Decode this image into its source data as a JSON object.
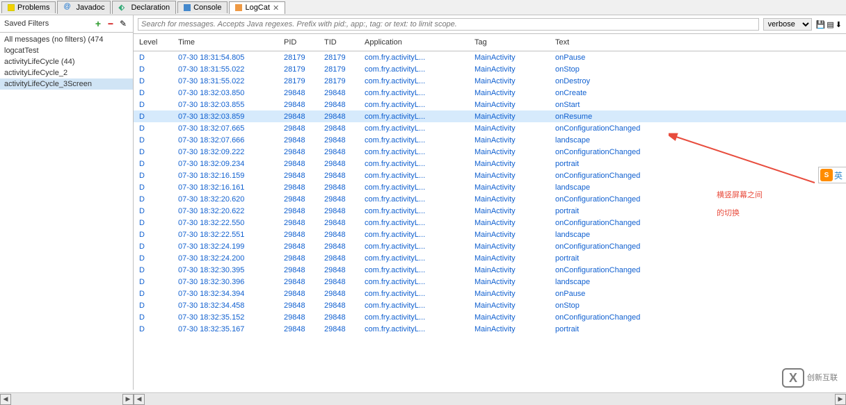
{
  "tabs": [
    {
      "label": "Problems",
      "icon": "problems-icon"
    },
    {
      "label": "Javadoc",
      "icon": "javadoc-icon"
    },
    {
      "label": "Declaration",
      "icon": "declaration-icon"
    },
    {
      "label": "Console",
      "icon": "console-icon"
    },
    {
      "label": "LogCat",
      "icon": "logcat-icon",
      "active": true,
      "closable": true
    }
  ],
  "sidebar": {
    "title": "Saved Filters",
    "filters": [
      {
        "label": "All messages (no filters) (474"
      },
      {
        "label": "logcatTest"
      },
      {
        "label": "activityLifeCycle (44)"
      },
      {
        "label": "activityLifeCycle_2"
      },
      {
        "label": "activityLifeCycle_3Screen",
        "selected": true
      }
    ]
  },
  "search": {
    "placeholder": "Search for messages. Accepts Java regexes. Prefix with pid:, app:, tag: or text: to limit scope.",
    "level": "verbose"
  },
  "columns": [
    "Level",
    "Time",
    "PID",
    "TID",
    "Application",
    "Tag",
    "Text"
  ],
  "rows": [
    {
      "level": "D",
      "time": "07-30 18:31:54.805",
      "pid": "28179",
      "tid": "28179",
      "app": "com.fry.activityL...",
      "tag": "MainActivity",
      "text": "onPause"
    },
    {
      "level": "D",
      "time": "07-30 18:31:55.022",
      "pid": "28179",
      "tid": "28179",
      "app": "com.fry.activityL...",
      "tag": "MainActivity",
      "text": "onStop"
    },
    {
      "level": "D",
      "time": "07-30 18:31:55.022",
      "pid": "28179",
      "tid": "28179",
      "app": "com.fry.activityL...",
      "tag": "MainActivity",
      "text": "onDestroy"
    },
    {
      "level": "D",
      "time": "07-30 18:32:03.850",
      "pid": "29848",
      "tid": "29848",
      "app": "com.fry.activityL...",
      "tag": "MainActivity",
      "text": "onCreate"
    },
    {
      "level": "D",
      "time": "07-30 18:32:03.855",
      "pid": "29848",
      "tid": "29848",
      "app": "com.fry.activityL...",
      "tag": "MainActivity",
      "text": "onStart"
    },
    {
      "level": "D",
      "time": "07-30 18:32:03.859",
      "pid": "29848",
      "tid": "29848",
      "app": "com.fry.activityL...",
      "tag": "MainActivity",
      "text": "onResume",
      "highlighted": true
    },
    {
      "level": "D",
      "time": "07-30 18:32:07.665",
      "pid": "29848",
      "tid": "29848",
      "app": "com.fry.activityL...",
      "tag": "MainActivity",
      "text": "onConfigurationChanged"
    },
    {
      "level": "D",
      "time": "07-30 18:32:07.666",
      "pid": "29848",
      "tid": "29848",
      "app": "com.fry.activityL...",
      "tag": "MainActivity",
      "text": "landscape"
    },
    {
      "level": "D",
      "time": "07-30 18:32:09.222",
      "pid": "29848",
      "tid": "29848",
      "app": "com.fry.activityL...",
      "tag": "MainActivity",
      "text": "onConfigurationChanged"
    },
    {
      "level": "D",
      "time": "07-30 18:32:09.234",
      "pid": "29848",
      "tid": "29848",
      "app": "com.fry.activityL...",
      "tag": "MainActivity",
      "text": "portrait"
    },
    {
      "level": "D",
      "time": "07-30 18:32:16.159",
      "pid": "29848",
      "tid": "29848",
      "app": "com.fry.activityL...",
      "tag": "MainActivity",
      "text": "onConfigurationChanged"
    },
    {
      "level": "D",
      "time": "07-30 18:32:16.161",
      "pid": "29848",
      "tid": "29848",
      "app": "com.fry.activityL...",
      "tag": "MainActivity",
      "text": "landscape"
    },
    {
      "level": "D",
      "time": "07-30 18:32:20.620",
      "pid": "29848",
      "tid": "29848",
      "app": "com.fry.activityL...",
      "tag": "MainActivity",
      "text": "onConfigurationChanged"
    },
    {
      "level": "D",
      "time": "07-30 18:32:20.622",
      "pid": "29848",
      "tid": "29848",
      "app": "com.fry.activityL...",
      "tag": "MainActivity",
      "text": "portrait"
    },
    {
      "level": "D",
      "time": "07-30 18:32:22.550",
      "pid": "29848",
      "tid": "29848",
      "app": "com.fry.activityL...",
      "tag": "MainActivity",
      "text": "onConfigurationChanged"
    },
    {
      "level": "D",
      "time": "07-30 18:32:22.551",
      "pid": "29848",
      "tid": "29848",
      "app": "com.fry.activityL...",
      "tag": "MainActivity",
      "text": "landscape"
    },
    {
      "level": "D",
      "time": "07-30 18:32:24.199",
      "pid": "29848",
      "tid": "29848",
      "app": "com.fry.activityL...",
      "tag": "MainActivity",
      "text": "onConfigurationChanged"
    },
    {
      "level": "D",
      "time": "07-30 18:32:24.200",
      "pid": "29848",
      "tid": "29848",
      "app": "com.fry.activityL...",
      "tag": "MainActivity",
      "text": "portrait"
    },
    {
      "level": "D",
      "time": "07-30 18:32:30.395",
      "pid": "29848",
      "tid": "29848",
      "app": "com.fry.activityL...",
      "tag": "MainActivity",
      "text": "onConfigurationChanged"
    },
    {
      "level": "D",
      "time": "07-30 18:32:30.396",
      "pid": "29848",
      "tid": "29848",
      "app": "com.fry.activityL...",
      "tag": "MainActivity",
      "text": "landscape"
    },
    {
      "level": "D",
      "time": "07-30 18:32:34.394",
      "pid": "29848",
      "tid": "29848",
      "app": "com.fry.activityL...",
      "tag": "MainActivity",
      "text": "onPause"
    },
    {
      "level": "D",
      "time": "07-30 18:32:34.458",
      "pid": "29848",
      "tid": "29848",
      "app": "com.fry.activityL...",
      "tag": "MainActivity",
      "text": "onStop"
    },
    {
      "level": "D",
      "time": "07-30 18:32:35.152",
      "pid": "29848",
      "tid": "29848",
      "app": "com.fry.activityL...",
      "tag": "MainActivity",
      "text": "onConfigurationChanged"
    },
    {
      "level": "D",
      "time": "07-30 18:32:35.167",
      "pid": "29848",
      "tid": "29848",
      "app": "com.fry.activityL...",
      "tag": "MainActivity",
      "text": "portrait"
    }
  ],
  "annotation": {
    "line1": "横竖屏幕之间",
    "line2": "的切换"
  },
  "floating_widget": {
    "logo": "S",
    "text": "英"
  },
  "watermark": {
    "mark": "X",
    "line1": "创新互联"
  }
}
